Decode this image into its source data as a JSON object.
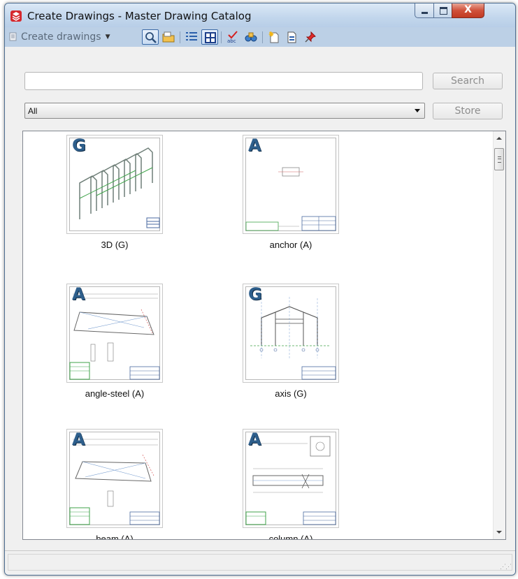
{
  "window": {
    "title": "Create Drawings - Master Drawing Catalog",
    "close_glyph": "X"
  },
  "toolbar": {
    "create_label": "Create drawings",
    "buttons": [
      {
        "name": "search-icon",
        "active": true
      },
      {
        "name": "open-folder-icon",
        "active": false
      },
      {
        "name": "list-view-icon",
        "active": false
      },
      {
        "name": "thumbnail-view-icon",
        "active": true
      },
      {
        "name": "spellcheck-icon",
        "active": false
      },
      {
        "name": "binoculars-icon",
        "active": false
      },
      {
        "name": "new-document-icon",
        "active": false
      },
      {
        "name": "properties-document-icon",
        "active": false
      },
      {
        "name": "pin-icon",
        "active": false
      }
    ]
  },
  "search": {
    "value": "",
    "placeholder": "",
    "button_label": "Search"
  },
  "filter": {
    "selected": "All",
    "store_label": "Store"
  },
  "catalog": {
    "items": [
      {
        "letter": "G",
        "label": "3D (G)",
        "kind": "3d"
      },
      {
        "letter": "A",
        "label": "anchor (A)",
        "kind": "anchor"
      },
      {
        "letter": "A",
        "label": "angle-steel (A)",
        "kind": "sheet"
      },
      {
        "letter": "G",
        "label": "axis (G)",
        "kind": "axis"
      },
      {
        "letter": "A",
        "label": "beam (A)",
        "kind": "sheet"
      },
      {
        "letter": "A",
        "label": "column (A)",
        "kind": "column"
      }
    ]
  },
  "colors": {
    "title_bar": "#c2d6ec",
    "close_button": "#c13a23",
    "catalog_letter": "#2e5f8c",
    "drawing_green": "#3fa34a"
  },
  "status": {
    "text": ""
  }
}
